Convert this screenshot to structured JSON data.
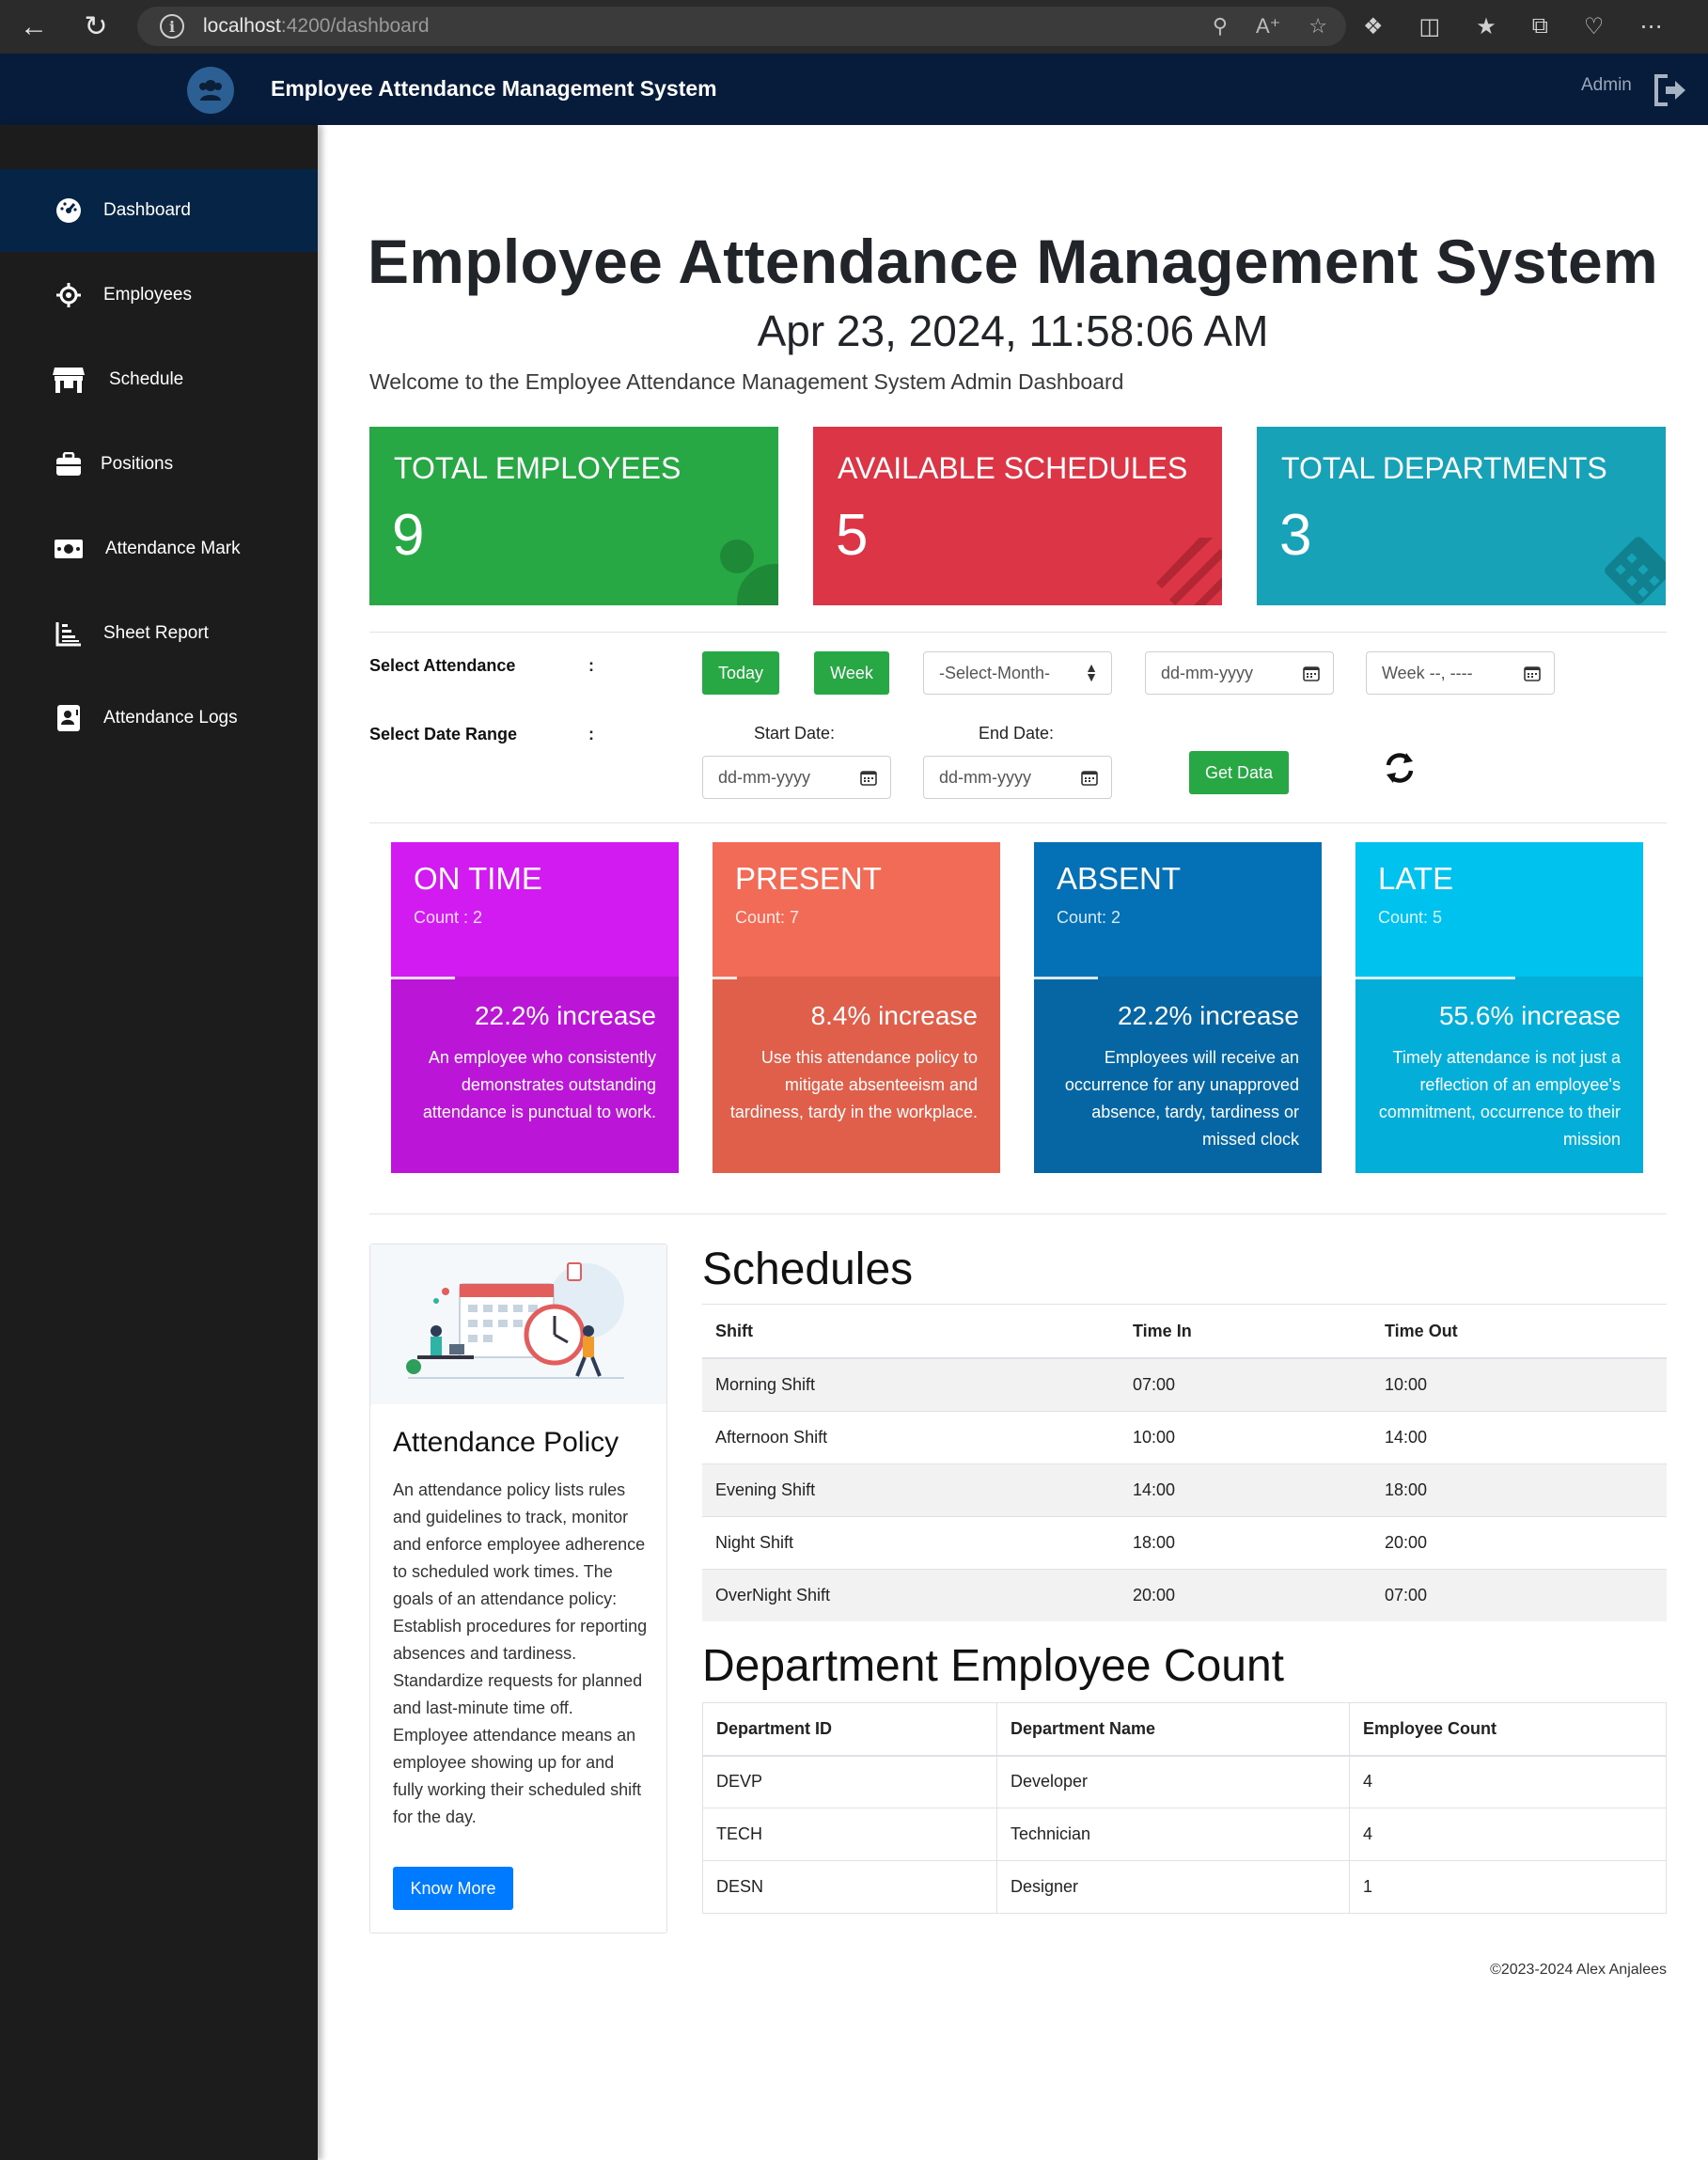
{
  "browser": {
    "url_host": "localhost",
    "url_path": ":4200/dashboard"
  },
  "header": {
    "title": "Employee Attendance Management System",
    "user": "Admin"
  },
  "sidebar": {
    "items": [
      {
        "label": "Dashboard",
        "icon": "dashboard-icon",
        "active": true
      },
      {
        "label": "Employees",
        "icon": "crosshair-icon"
      },
      {
        "label": "Schedule",
        "icon": "store-icon"
      },
      {
        "label": "Positions",
        "icon": "briefcase-icon"
      },
      {
        "label": "Attendance Mark",
        "icon": "money-icon"
      },
      {
        "label": "Sheet Report",
        "icon": "chart-icon"
      },
      {
        "label": "Attendance Logs",
        "icon": "id-card-icon"
      }
    ]
  },
  "main": {
    "title": "Employee Attendance Management System",
    "datetime": "Apr 23, 2024, 11:58:06 AM",
    "welcome": "Welcome to the Employee Attendance Management System Admin Dashboard"
  },
  "stats": [
    {
      "label": "TOTAL EMPLOYEES",
      "value": "9",
      "color": "#28a745"
    },
    {
      "label": "AVAILABLE SCHEDULES",
      "value": "5",
      "color": "#dc3545"
    },
    {
      "label": "TOTAL DEPARTMENTS",
      "value": "3",
      "color": "#17a2b8"
    }
  ],
  "filters": {
    "select_attendance_label": "Select Attendance",
    "select_range_label": "Select Date Range",
    "colon": ":",
    "today_button": "Today",
    "week_button": "Week",
    "month_select": "-Select-Month-",
    "date_placeholder": "dd-mm-yyyy",
    "week_placeholder": "Week --, ----",
    "start_date_label": "Start Date:",
    "end_date_label": "End Date:",
    "get_data_button": "Get Data"
  },
  "attendance": [
    {
      "title": "ON TIME",
      "count": "Count : 2",
      "increase": "22.2% increase",
      "desc": "An employee who consistently demonstrates outstanding attendance is punctual to work.",
      "top_color": "#d21bf0",
      "bottom_color": "#bb15d8"
    },
    {
      "title": "PRESENT",
      "count": "Count: 7",
      "increase": "8.4% increase",
      "desc": "Use this attendance policy to mitigate absenteeism and tardiness, tardy in the workplace.",
      "top_color": "#f26b56",
      "bottom_color": "#df5f4b"
    },
    {
      "title": "ABSENT",
      "count": "Count: 2",
      "increase": "22.2% increase",
      "desc": "Employees will receive an occurrence for any unapproved absence, tardy, tardiness or missed clock",
      "top_color": "#0471b6",
      "bottom_color": "#0665a3"
    },
    {
      "title": "LATE",
      "count": "Count: 5",
      "increase": "55.6% increase",
      "desc": "Timely attendance is not just a reflection of an employee's commitment, occurrence to their mission",
      "top_color": "#00c2ee",
      "bottom_color": "#03afd9"
    }
  ],
  "policy": {
    "title": "Attendance Policy",
    "text": "An attendance policy lists rules and guidelines to track, monitor and enforce employee adherence to scheduled work times. The goals of an attendance policy: Establish procedures for reporting absences and tardiness. Standardize requests for planned and last-minute time off. Employee attendance means an employee showing up for and fully working their scheduled shift for the day.",
    "button": "Know More"
  },
  "schedules": {
    "title": "Schedules",
    "headers": [
      "Shift",
      "Time In",
      "Time Out"
    ],
    "rows": [
      [
        "Morning Shift",
        "07:00",
        "10:00"
      ],
      [
        "Afternoon Shift",
        "10:00",
        "14:00"
      ],
      [
        "Evening Shift",
        "14:00",
        "18:00"
      ],
      [
        "Night Shift",
        "18:00",
        "20:00"
      ],
      [
        "OverNight Shift",
        "20:00",
        "07:00"
      ]
    ]
  },
  "departments": {
    "title": "Department Employee Count",
    "headers": [
      "Department ID",
      "Department Name",
      "Employee Count"
    ],
    "rows": [
      [
        "DEVP",
        "Developer",
        "4"
      ],
      [
        "TECH",
        "Technician",
        "4"
      ],
      [
        "DESN",
        "Designer",
        "1"
      ]
    ]
  },
  "footer": "©2023-2024 Alex Anjalees"
}
